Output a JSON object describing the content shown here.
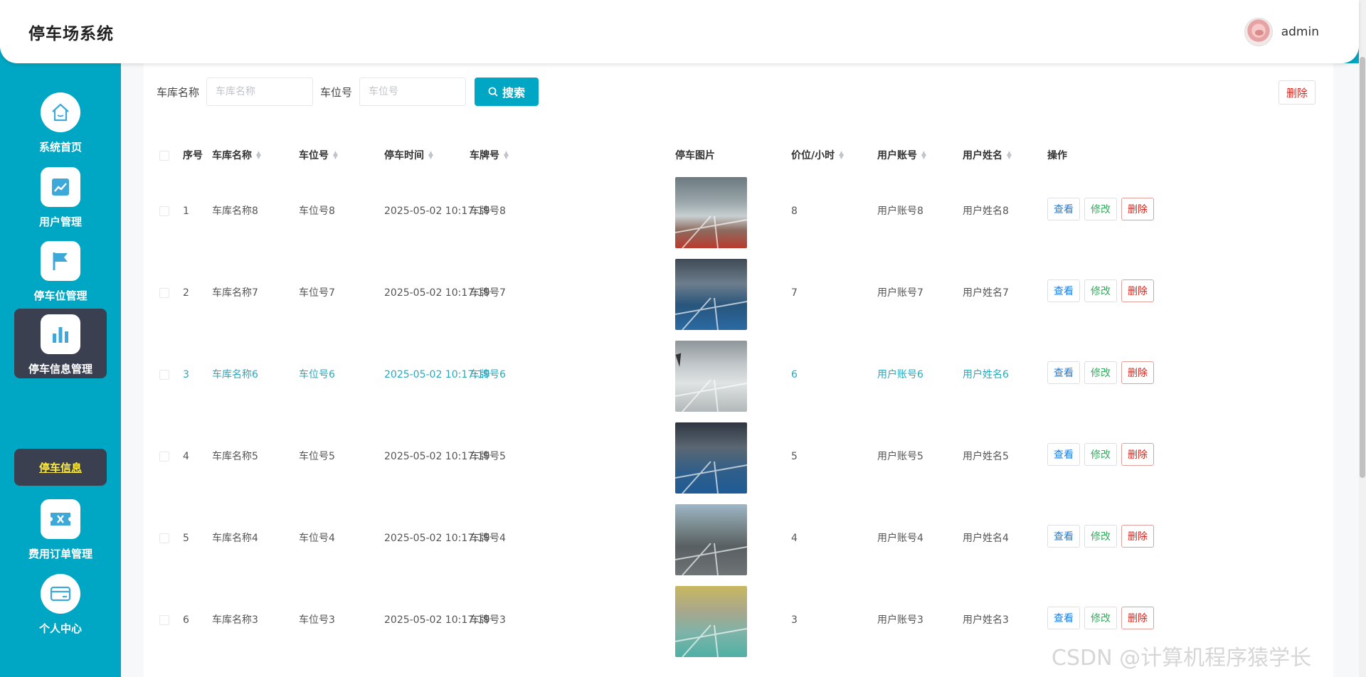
{
  "header": {
    "title": "停车场系统",
    "username": "admin"
  },
  "sidebar": {
    "items": [
      {
        "label": "系统首页",
        "icon": "home-icon"
      },
      {
        "label": "用户管理",
        "icon": "chart-line-icon"
      },
      {
        "label": "停车位管理",
        "icon": "flag-icon"
      },
      {
        "label": "停车信息管理",
        "icon": "bar-chart-icon"
      },
      {
        "label": "费用订单管理",
        "icon": "ticket-icon"
      },
      {
        "label": "个人中心",
        "icon": "card-icon"
      }
    ],
    "submenu_label": "停车信息"
  },
  "search": {
    "garage_label": "车库名称",
    "garage_placeholder": "车库名称",
    "spot_label": "车位号",
    "spot_placeholder": "车位号",
    "button_label": "搜索",
    "delete_label": "删除"
  },
  "table": {
    "headers": {
      "index": "序号",
      "garage": "车库名称",
      "spot": "车位号",
      "time": "停车时间",
      "plate": "车牌号",
      "photo": "停车图片",
      "price": "价位/小时",
      "account": "用户账号",
      "name": "用户姓名",
      "ops": "操作"
    },
    "rows": [
      {
        "index": "1",
        "garage": "车库名称8",
        "spot": "车位号8",
        "time": "2025-05-02 10:17:19",
        "plate": "车牌号8",
        "price": "8",
        "account": "用户账号8",
        "name": "用户姓名8"
      },
      {
        "index": "2",
        "garage": "车库名称7",
        "spot": "车位号7",
        "time": "2025-05-02 10:17:19",
        "plate": "车牌号7",
        "price": "7",
        "account": "用户账号7",
        "name": "用户姓名7"
      },
      {
        "index": "3",
        "garage": "车库名称6",
        "spot": "车位号6",
        "time": "2025-05-02 10:17:19",
        "plate": "车牌号6",
        "price": "6",
        "account": "用户账号6",
        "name": "用户姓名6"
      },
      {
        "index": "4",
        "garage": "车库名称5",
        "spot": "车位号5",
        "time": "2025-05-02 10:17:19",
        "plate": "车牌号5",
        "price": "5",
        "account": "用户账号5",
        "name": "用户姓名5"
      },
      {
        "index": "5",
        "garage": "车库名称4",
        "spot": "车位号4",
        "time": "2025-05-02 10:17:19",
        "plate": "车牌号4",
        "price": "4",
        "account": "用户账号4",
        "name": "用户姓名4"
      },
      {
        "index": "6",
        "garage": "车库名称3",
        "spot": "车位号3",
        "time": "2025-05-02 10:17:19",
        "plate": "车牌号3",
        "price": "3",
        "account": "用户账号3",
        "name": "用户姓名3"
      }
    ],
    "ops": {
      "view": "查看",
      "edit": "修改",
      "delete": "删除"
    }
  },
  "watermark": "CSDN @计算机程序猿学长",
  "colors": {
    "accent": "#00a7c4",
    "sidebar_active": "#3a4050",
    "highlight_text": "#27a9bf",
    "danger": "#d9251c",
    "success": "#2fae5c",
    "primary": "#1b7ee0"
  }
}
